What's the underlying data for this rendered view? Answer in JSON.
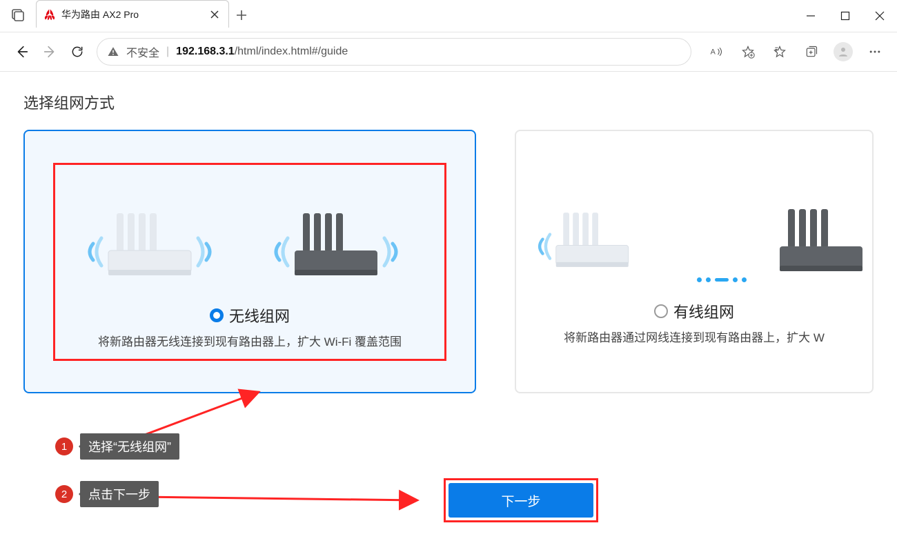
{
  "browser": {
    "tab_title": "华为路由 AX2 Pro",
    "security_label": "不安全",
    "url_host": "192.168.3.1",
    "url_path": "/html/index.html#/guide"
  },
  "page": {
    "title": "选择组网方式",
    "option_wireless": {
      "title": "无线组网",
      "desc": "将新路由器无线连接到现有路由器上，扩大 Wi-Fi 覆盖范围"
    },
    "option_wired": {
      "title": "有线组网",
      "desc": "将新路由器通过网线连接到现有路由器上，扩大 W"
    },
    "next_button": "下一步"
  },
  "callouts": {
    "c1_num": "1",
    "c1_text": "选择“无线组网”",
    "c2_num": "2",
    "c2_text": "点击下一步"
  }
}
